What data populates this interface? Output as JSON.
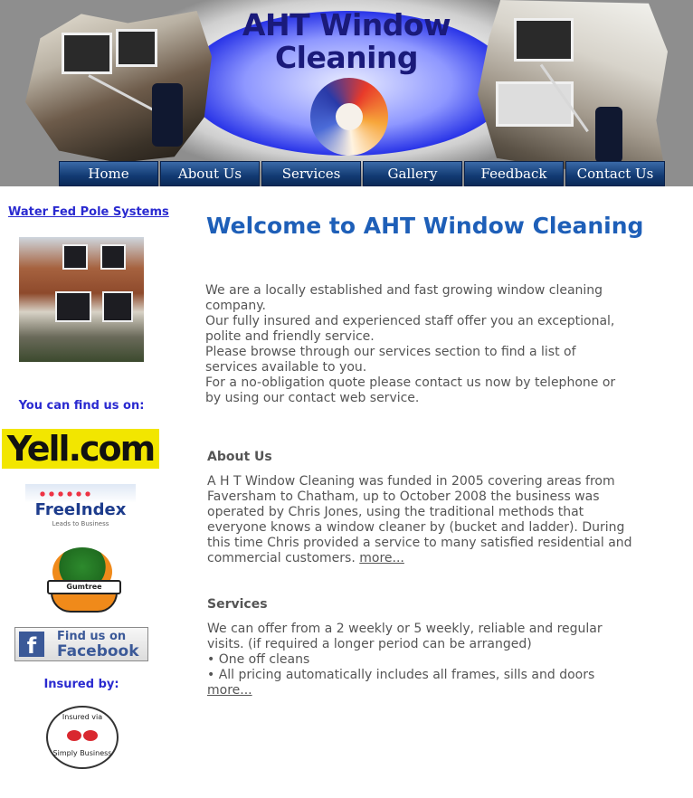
{
  "header": {
    "title_line1": "AHT Window",
    "title_line2": "Cleaning"
  },
  "nav": {
    "items": [
      "Home",
      "About Us",
      "Services",
      "Gallery",
      "Feedback",
      "Contact Us"
    ]
  },
  "sidebar": {
    "top_link": "Water Fed Pole Systems",
    "find_us_heading": "You can find us on:",
    "yell_logo": "Yell.com",
    "freeindex_logo": "FreeIndex",
    "freeindex_tagline": "Leads to Business",
    "gumtree_logo": "Gumtree",
    "facebook_line1": "Find us on",
    "facebook_line2": "Facebook",
    "insured_heading": "Insured by:",
    "seal_top": "Insured via",
    "seal_bottom": "Simply Business"
  },
  "main": {
    "welcome_heading": "Welcome to AHT Window Cleaning",
    "intro_lines": [
      "We are a locally established and fast growing window cleaning company.",
      "Our fully insured and experienced staff offer you an exceptional, polite and friendly service.",
      "Please browse through our services section to find a list of services available to you.",
      "For a no-obligation quote please contact us now by telephone or by using our contact web service."
    ],
    "about_heading": "About Us",
    "about_text": "A H T Window Cleaning was funded in 2005 covering areas from Faversham to Chatham, up to October 2008 the business was operated by Chris Jones, using the traditional methods that everyone knows a window cleaner by (bucket and ladder). During this time Chris provided a service to many satisfied residential and commercial customers. ",
    "about_more": "more...",
    "services_heading": "Services",
    "services_intro": "We can offer from a 2 weekly or 5 weekly, reliable and regular visits. (if required a longer period can be arranged)",
    "services_bullets": [
      "• One off cleans",
      "• All pricing automatically includes all frames, sills and doors"
    ],
    "services_more": "more..."
  }
}
